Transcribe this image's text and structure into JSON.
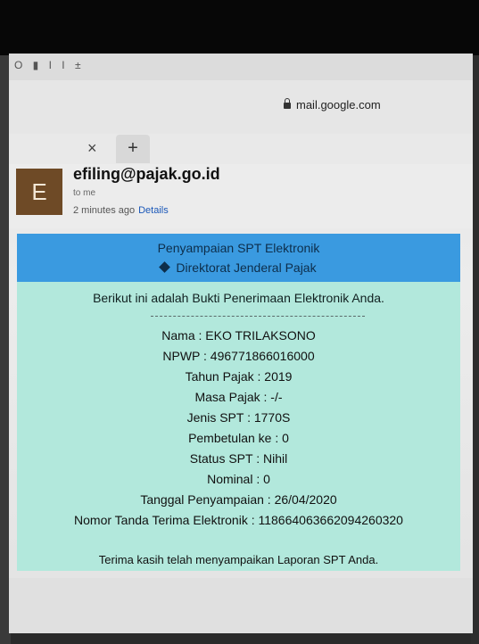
{
  "status": {
    "icons": "O ▮ I I ±"
  },
  "browser": {
    "url": "mail.google.com",
    "close_tab": "×",
    "new_tab": "+"
  },
  "email": {
    "avatar_letter": "E",
    "sender": "efiling@pajak.go.id",
    "to": "to me",
    "time": "2 minutes ago",
    "details_link": "Details"
  },
  "banner": {
    "title": "Penyampaian SPT Elektronik",
    "subtitle": "Direktorat Jenderal Pajak"
  },
  "body": {
    "intro": "Berikut ini adalah Bukti Penerimaan Elektronik Anda.",
    "fields": [
      "Nama : EKO TRILAKSONO",
      "NPWP : 496771866016000",
      "Tahun Pajak : 2019",
      "Masa Pajak : -/-",
      "Jenis SPT : 1770S",
      "Pembetulan ke : 0",
      "Status SPT : Nihil",
      "Nominal : 0",
      "Tanggal Penyampaian : 26/04/2020",
      "Nomor Tanda Terima Elektronik : 118664063662094260320"
    ],
    "thanks": "Terima kasih telah menyampaikan Laporan SPT Anda."
  },
  "colors": {
    "banner": "#3a9ae0",
    "card": "#b2e8dc",
    "avatar": "#6e4a26",
    "link": "#1a57b8"
  }
}
